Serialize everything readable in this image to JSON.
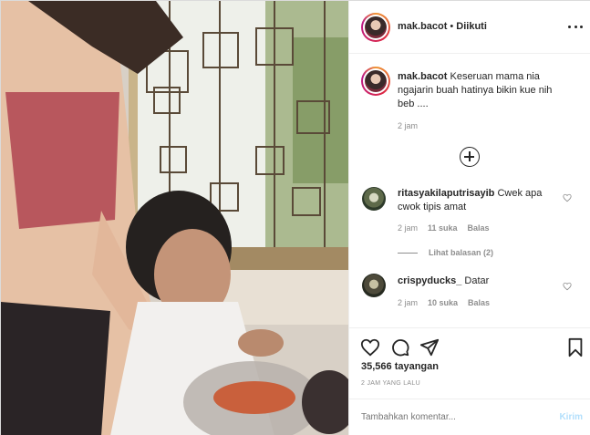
{
  "post": {
    "username": "mak.bacot",
    "separator": "•",
    "follow_status": "Diikuti",
    "caption_text": "Keseruan mama nia ngajarin buah hatinya bikin kue nih beb ....",
    "caption_time": "2 jam"
  },
  "comments": [
    {
      "username": "ritasyakilaputrisayib",
      "text": "Cwek apa cwok tipis amat",
      "time": "2 jam",
      "likes": "11 suka",
      "reply_label": "Balas",
      "view_replies": "Lihat balasan (2)"
    },
    {
      "username": "crispyducks_",
      "text": "Datar",
      "time": "2 jam",
      "likes": "10 suka",
      "reply_label": "Balas"
    }
  ],
  "stats": {
    "views": "35,566 tayangan",
    "posted": "2 JAM YANG LALU"
  },
  "composer": {
    "placeholder": "Tambahkan komentar...",
    "post_label": "Kirim"
  },
  "icons": {
    "more": "more-horizontal-icon",
    "load_more": "plus-circle-icon",
    "like": "heart-icon",
    "comment": "comment-bubble-icon",
    "share": "paper-plane-icon",
    "save": "bookmark-icon"
  },
  "colors": {
    "text": "#262626",
    "muted": "#8e8e8e",
    "border": "#efefef",
    "post_button_disabled": "#b2dffc"
  }
}
